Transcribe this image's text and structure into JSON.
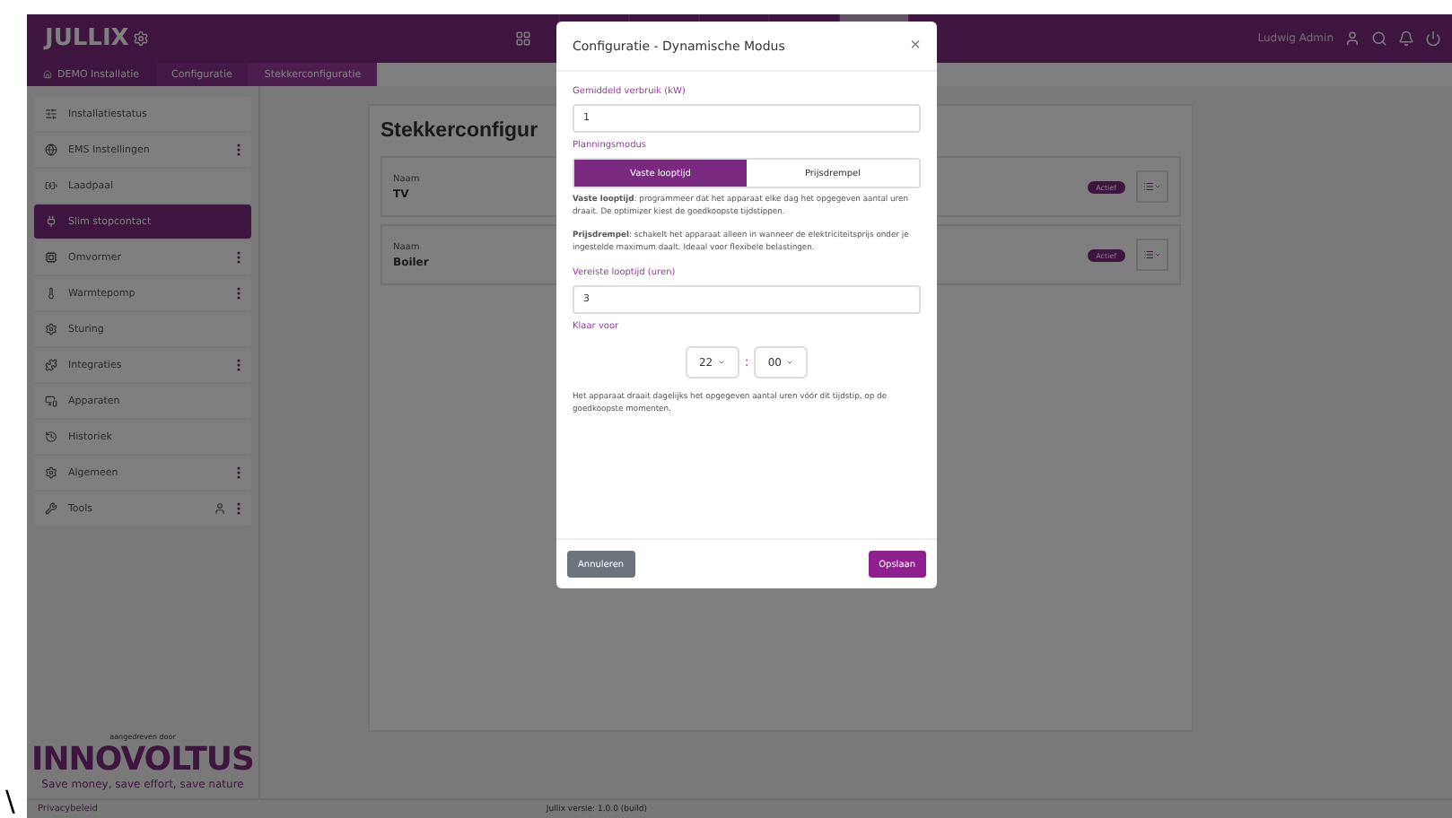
{
  "header": {
    "logo": "JULLIX",
    "nav": [
      {
        "selected": false
      },
      {
        "selected": false
      },
      {
        "selected": false
      },
      {
        "selected": false
      },
      {
        "selected": false
      },
      {
        "selected": true
      }
    ],
    "user": "Ludwig Admin"
  },
  "breadcrumb": [
    "DEMO Installatie",
    "Configuratie",
    "Stekkerconfiguratie"
  ],
  "sidebar": {
    "items": [
      {
        "label": "Installatiestatus",
        "selected": false,
        "menu": false
      },
      {
        "label": "EMS Instellingen",
        "selected": false,
        "menu": true
      },
      {
        "label": "Laadpaal",
        "selected": false,
        "menu": false
      },
      {
        "label": "Slim stopcontact",
        "selected": true,
        "menu": false
      },
      {
        "label": "Omvormer",
        "selected": false,
        "menu": true
      },
      {
        "label": "Warmtepomp",
        "selected": false,
        "menu": true
      },
      {
        "label": "Sturing",
        "selected": false,
        "menu": false
      },
      {
        "label": "Integraties",
        "selected": false,
        "menu": true
      },
      {
        "label": "Apparaten",
        "selected": false,
        "menu": false
      },
      {
        "label": "Historiek",
        "selected": false,
        "menu": false
      },
      {
        "label": "Algemeen",
        "selected": false,
        "menu": true
      },
      {
        "label": "Tools",
        "selected": false,
        "menu": true
      }
    ],
    "powered_by": "aangedreven door",
    "brand": "INNOVOLTUS",
    "slogan": "Save money, save effort, save nature"
  },
  "main": {
    "title": "Stekkerconfigur",
    "plugs": [
      {
        "caption": "Naam",
        "name": "TV",
        "status": "Actief"
      },
      {
        "caption": "Naam",
        "name": "Boiler",
        "status": "Actief"
      }
    ]
  },
  "modal": {
    "title": "Configuratie - Dynamische Modus",
    "close": "×",
    "usage": {
      "label": "Gemiddeld verbruik (kW)",
      "value": "1"
    },
    "mode": {
      "label": "Planningsmodus",
      "options": [
        {
          "label": "Vaste looptijd",
          "selected": true
        },
        {
          "label": "Prijsdrempel",
          "selected": false
        }
      ]
    },
    "help": [
      "**Vaste looptijd**: programmeer dat het apparaat elke dag het opgegeven aantal uren draait. De optimizer kiest de goedkoopste tijdstippen.",
      "**Prijsdrempel**: schakelt het apparaat alleen in wanneer de elektriciteitsprijs onder je ingestelde maximum daalt. Ideaal voor flexibele belastingen."
    ],
    "runtime": {
      "label": "Vereiste looptijd (uren)",
      "value": "3"
    },
    "ready": {
      "label": "Klaar voor",
      "hour": "22",
      "separator": ":",
      "minute": "00"
    },
    "note": "Het apparaat draait dagelijks het opgegeven aantal uren vóór dit tijdstip, op de goedkoopste momenten.",
    "cancel": "Annuleren",
    "save": "Opslaan"
  },
  "footer": {
    "left": "Privacybeleid",
    "center": "Jullix versie: 1.0.0 (build)"
  },
  "stray_mark": "\\"
}
